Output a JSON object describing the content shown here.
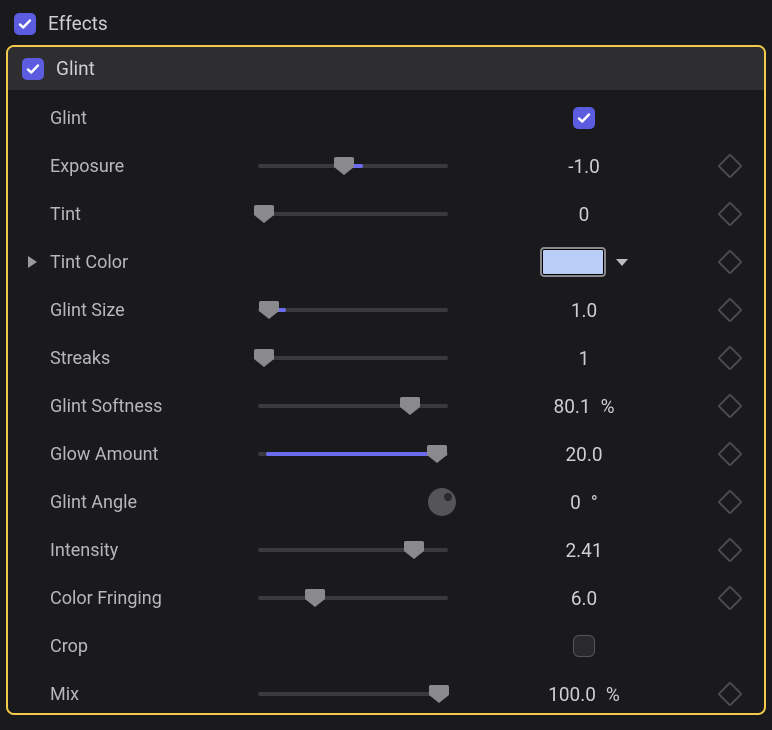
{
  "colors": {
    "accent": "#5b5ce0",
    "highlight": "#f2c94c",
    "swatch": "#b9cdf7"
  },
  "header": {
    "title": "Effects",
    "enabled": true
  },
  "effect": {
    "name": "Glint",
    "enabled": true,
    "params": [
      {
        "key": "glint_toggle",
        "label": "Glint",
        "type": "checkbox",
        "checked": true
      },
      {
        "key": "exposure",
        "label": "Exposure",
        "type": "slider",
        "value": "-1.0",
        "fill_from": 45,
        "fill_to": 55,
        "thumb": 45,
        "keyframe": true
      },
      {
        "key": "tint",
        "label": "Tint",
        "type": "slider",
        "value": "0",
        "fill_from": 0,
        "fill_to": 0,
        "thumb": 3,
        "keyframe": true
      },
      {
        "key": "tint_color",
        "label": "Tint Color",
        "type": "color",
        "swatch": "#b9cdf7",
        "disclosure": true,
        "keyframe": true
      },
      {
        "key": "glint_size",
        "label": "Glint Size",
        "type": "slider",
        "value": "1.0",
        "fill_from": 4,
        "fill_to": 15,
        "thumb": 6,
        "keyframe": true
      },
      {
        "key": "streaks",
        "label": "Streaks",
        "type": "slider",
        "value": "1",
        "fill_from": 0,
        "fill_to": 0,
        "thumb": 3,
        "keyframe": true
      },
      {
        "key": "glint_softness",
        "label": "Glint Softness",
        "type": "slider",
        "value": "80.1",
        "unit": "%",
        "fill_from": 0,
        "fill_to": 0,
        "thumb": 80,
        "keyframe": true
      },
      {
        "key": "glow_amount",
        "label": "Glow Amount",
        "type": "slider",
        "value": "20.0",
        "fill_from": 4,
        "fill_to": 94,
        "thumb": 94,
        "keyframe": true
      },
      {
        "key": "glint_angle",
        "label": "Glint Angle",
        "type": "dial",
        "value": "0",
        "unit": "°",
        "keyframe": true
      },
      {
        "key": "intensity",
        "label": "Intensity",
        "type": "slider",
        "value": "2.41",
        "fill_from": 82,
        "fill_to": 87,
        "thumb": 82,
        "keyframe": true
      },
      {
        "key": "color_fringing",
        "label": "Color Fringing",
        "type": "slider",
        "value": "6.0",
        "fill_from": 0,
        "fill_to": 0,
        "thumb": 30,
        "keyframe": true
      },
      {
        "key": "crop",
        "label": "Crop",
        "type": "checkbox",
        "checked": false
      },
      {
        "key": "mix",
        "label": "Mix",
        "type": "slider",
        "value": "100.0",
        "unit": "%",
        "fill_from": 0,
        "fill_to": 0,
        "thumb": 95,
        "keyframe": true
      }
    ]
  }
}
